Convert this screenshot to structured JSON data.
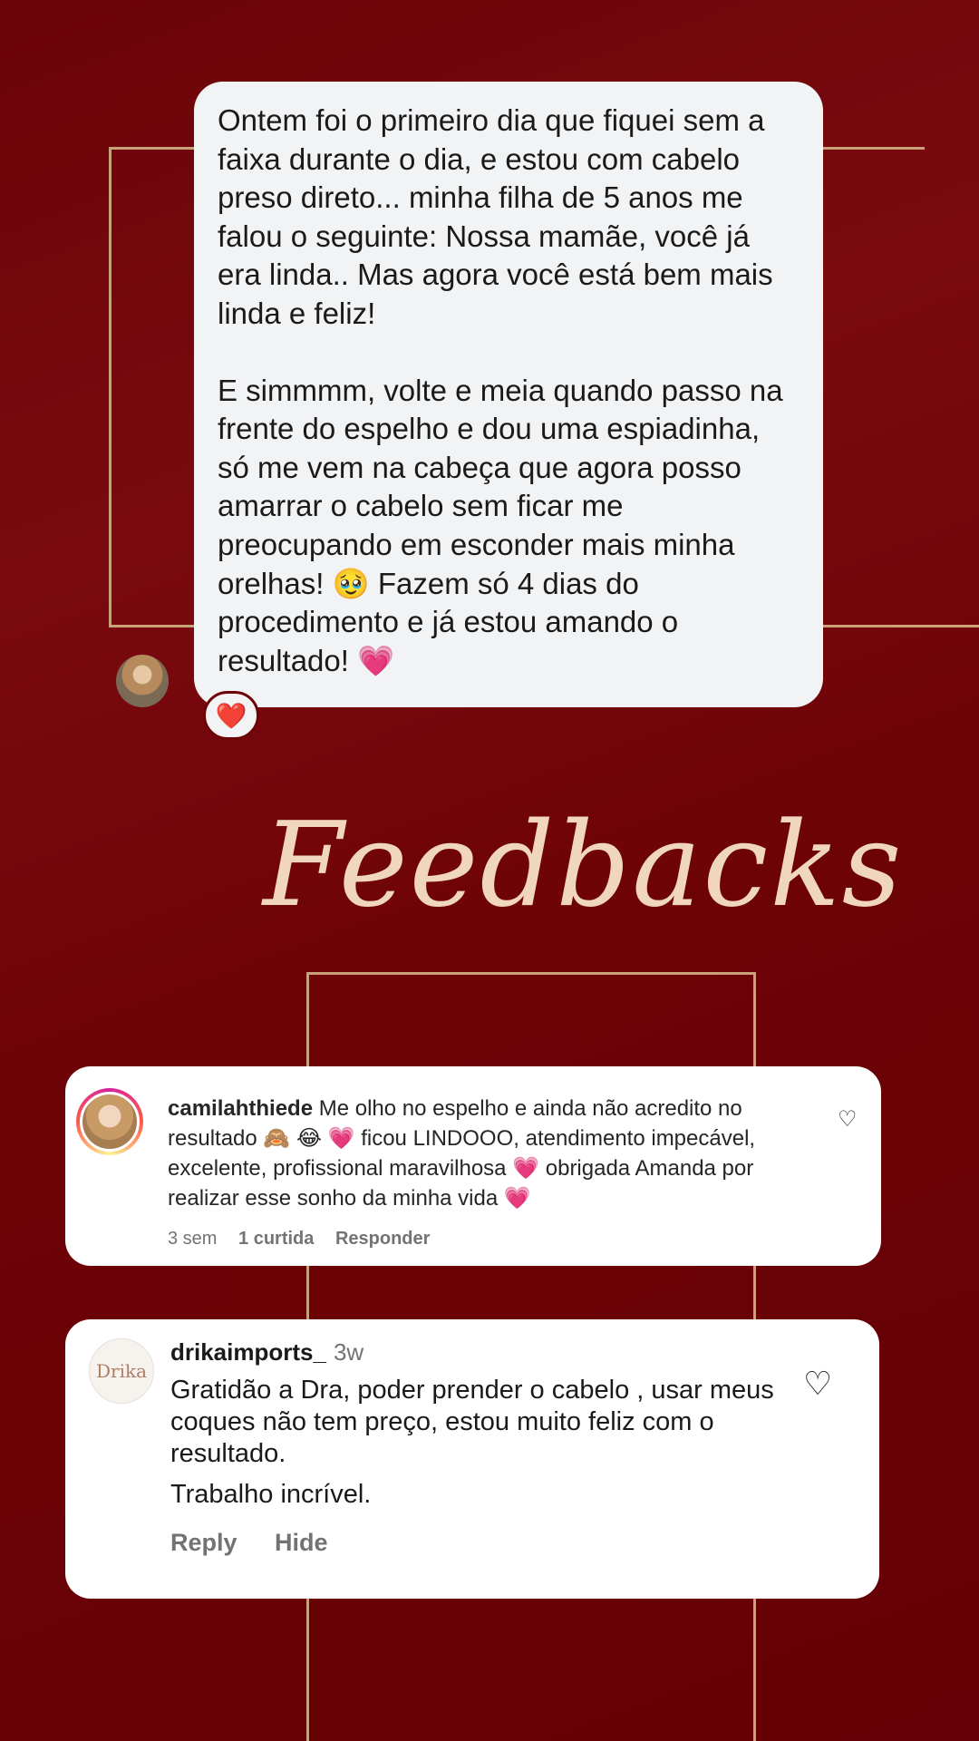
{
  "dm": {
    "paragraph1": "Ontem foi o primeiro dia que fiquei sem a faixa durante o dia, e estou com cabelo preso direto... minha filha de 5 anos me falou o seguinte: Nossa mamãe, você já era linda.. Mas agora você está bem mais linda e feliz!",
    "paragraph2": "E simmmm, volte e meia quando passo na frente do espelho e dou uma espiadinha, só me vem na cabeça que agora posso amarrar o cabelo sem ficar me preocupando em esconder mais minha orelhas! 🥹 Fazem só 4 dias do procedimento e já estou amando o resultado! 💗",
    "reaction": "❤️"
  },
  "title": "Feedbacks",
  "comment1": {
    "username": "camilahthiede",
    "text": "Me olho no espelho e ainda não acredito no resultado 🙈 😂 💗 ficou LINDOOO, atendimento impecável, excelente, profissional maravilhosa 💗 obrigada Amanda por realizar esse sonho da minha vida 💗",
    "time": "3 sem",
    "likes": "1 curtida",
    "reply": "Responder"
  },
  "comment2": {
    "avatar_text": "Drika",
    "username": "drikaimports_",
    "time": "3w",
    "text1": "Gratidão a Dra, poder prender o cabelo , usar meus coques não tem preço, estou muito feliz com o resultado.",
    "text2": "Trabalho incrível.",
    "reply": "Reply",
    "hide": "Hide"
  },
  "icons": {
    "heart_outline": "♡"
  },
  "colors": {
    "background": "#6d0307",
    "gold": "#c9a27a",
    "title": "#f0d6bf"
  }
}
